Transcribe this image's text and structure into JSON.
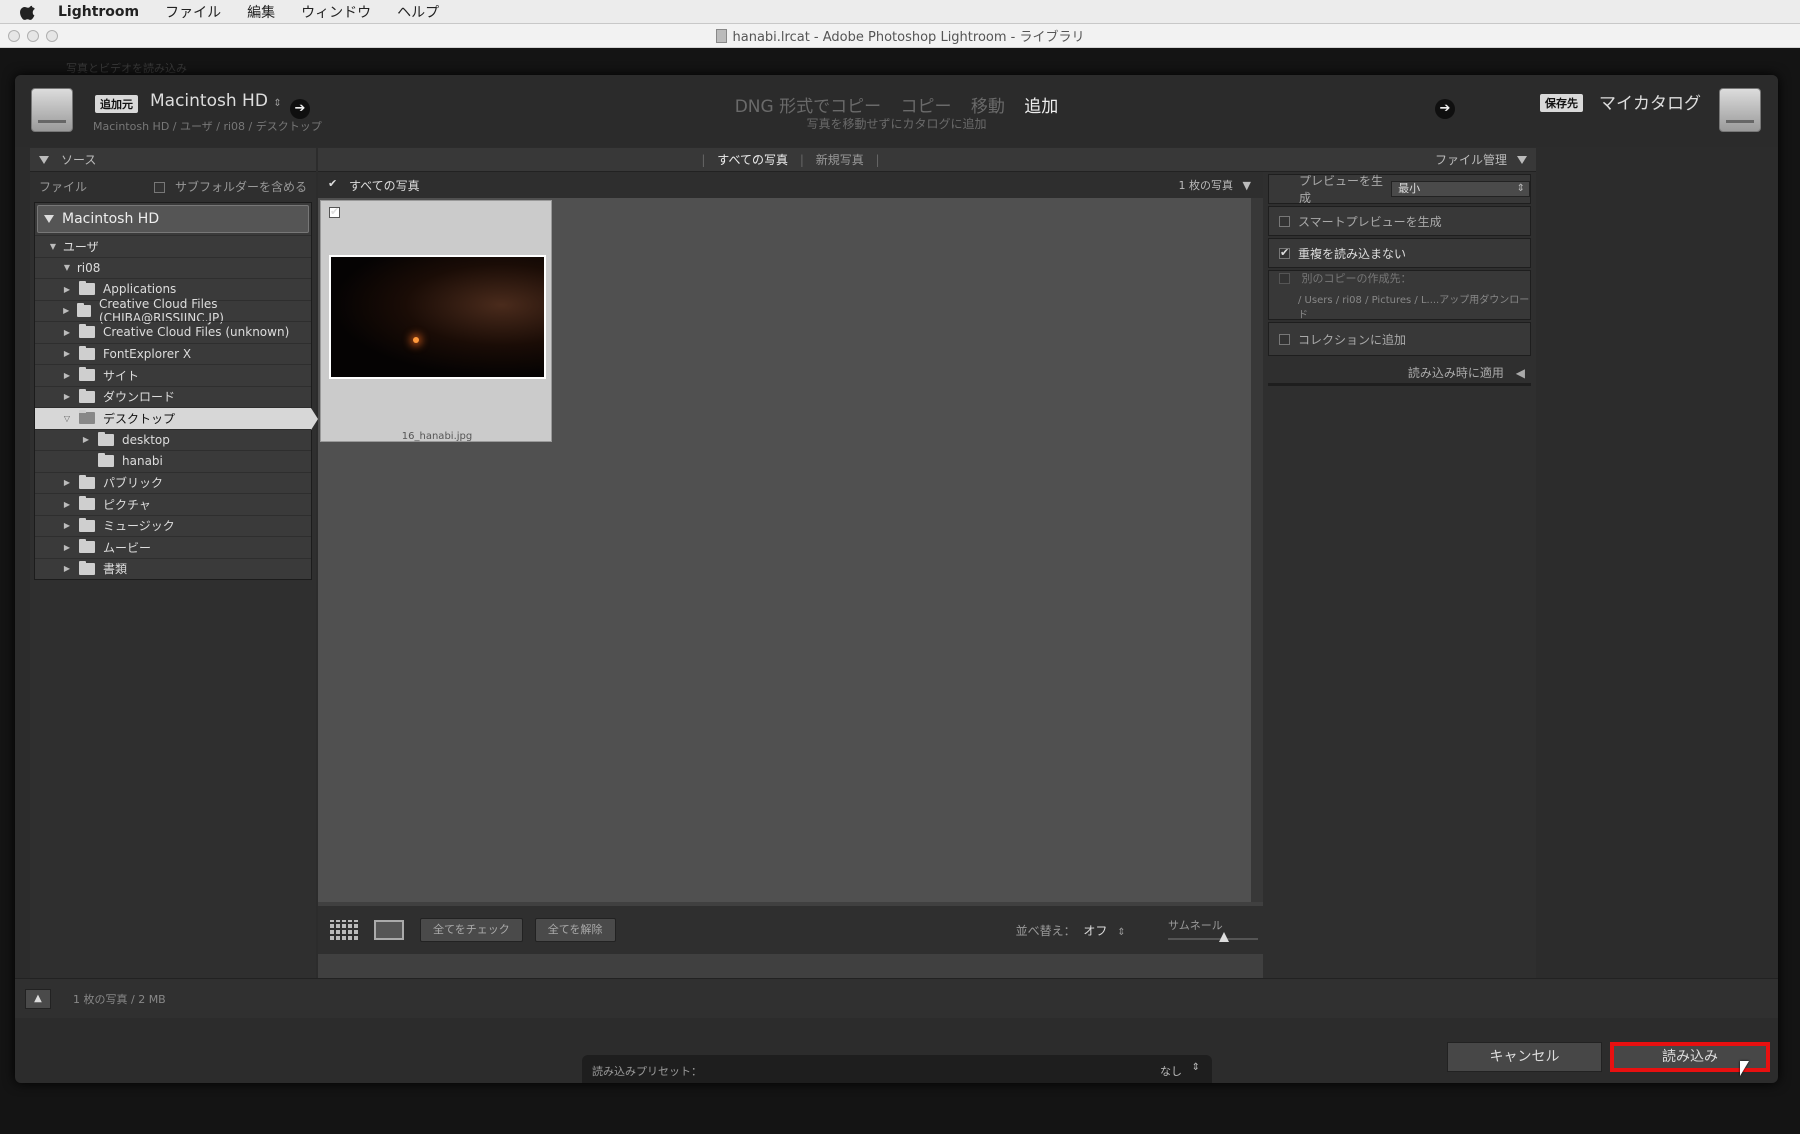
{
  "menubar": {
    "app": "Lightroom",
    "items": [
      "ファイル",
      "編集",
      "ウィンドウ",
      "ヘルプ"
    ]
  },
  "window": {
    "title": "hanabi.lrcat - Adobe Photoshop Lightroom - ライブラリ"
  },
  "background_window": {
    "ghost_title": "写真とビデオを読み込み"
  },
  "header": {
    "source_tag": "追加元",
    "source_name": "Macintosh HD",
    "source_path": "Macintosh HD / ユーザ / ri08 / デスクトップ",
    "modes": [
      "DNG 形式でコピー",
      "コピー",
      "移動",
      "追加"
    ],
    "active_mode": "追加",
    "mode_description": "写真を移動せずにカタログに追加",
    "dest_tag": "保存先",
    "dest_name": "マイカタログ"
  },
  "source_panel": {
    "title": "ソース",
    "file_label": "ファイル",
    "subfolders_label": "サブフォルダーを含める",
    "volume": "Macintosh HD",
    "tree": [
      {
        "label": "ユーザ",
        "level": 1,
        "expanded": true,
        "folder": false
      },
      {
        "label": "ri08",
        "level": 2,
        "expanded": true,
        "folder": false
      },
      {
        "label": "Applications",
        "level": 3,
        "expanded": false,
        "folder": true
      },
      {
        "label": "Creative Cloud Files (CHIBA@RISSIINC.JP)",
        "level": 3,
        "expanded": false,
        "folder": true
      },
      {
        "label": "Creative Cloud Files (unknown)",
        "level": 3,
        "expanded": false,
        "folder": true
      },
      {
        "label": "FontExplorer X",
        "level": 3,
        "expanded": false,
        "folder": true
      },
      {
        "label": "サイト",
        "level": 3,
        "expanded": false,
        "folder": true
      },
      {
        "label": "ダウンロード",
        "level": 3,
        "expanded": false,
        "folder": true
      },
      {
        "label": "デスクトップ",
        "level": 3,
        "expanded": true,
        "folder": true,
        "selected": true
      },
      {
        "label": "desktop",
        "level": 4,
        "expanded": false,
        "folder": true
      },
      {
        "label": "hanabi",
        "level": 4,
        "expanded": false,
        "folder": true,
        "noarrow": true
      },
      {
        "label": "パブリック",
        "level": 3,
        "expanded": false,
        "folder": true
      },
      {
        "label": "ピクチャ",
        "level": 3,
        "expanded": false,
        "folder": true
      },
      {
        "label": "ミュージック",
        "level": 3,
        "expanded": false,
        "folder": true
      },
      {
        "label": "ムービー",
        "level": 3,
        "expanded": false,
        "folder": true
      },
      {
        "label": "書類",
        "level": 3,
        "expanded": false,
        "folder": true
      }
    ]
  },
  "grid": {
    "tab_all": "すべての写真",
    "tab_new": "新規写真",
    "bar_label": "すべての写真",
    "count": "1 枚の写真",
    "thumbnail_name": "16_hanabi.jpg",
    "check_all": "全てをチェック",
    "uncheck_all": "全てを解除",
    "sort_label": "並べ替え：",
    "sort_value": "オフ",
    "thumb_label": "サムネール",
    "thumb_size": 0.62
  },
  "file_panel": {
    "title": "ファイル管理",
    "preview_label": "プレビューを生成",
    "preview_value": "最小",
    "smart_preview": "スマートプレビューを生成",
    "no_dupes": "重複を読み込まない",
    "second_copy": "別のコピーの作成先：",
    "second_copy_path": "/ Users / ri08 / Pictures / L....アップ用ダウンロード",
    "add_collection": "コレクションに追加",
    "apply_during_import": "読み込み時に適用"
  },
  "footer": {
    "summary": "1 枚の写真 / 2 MB",
    "preset_label": "読み込みプリセット：",
    "preset_value": "なし",
    "cancel": "キャンセル",
    "import": "読み込み"
  },
  "colors": {
    "highlight": "#e81010"
  }
}
